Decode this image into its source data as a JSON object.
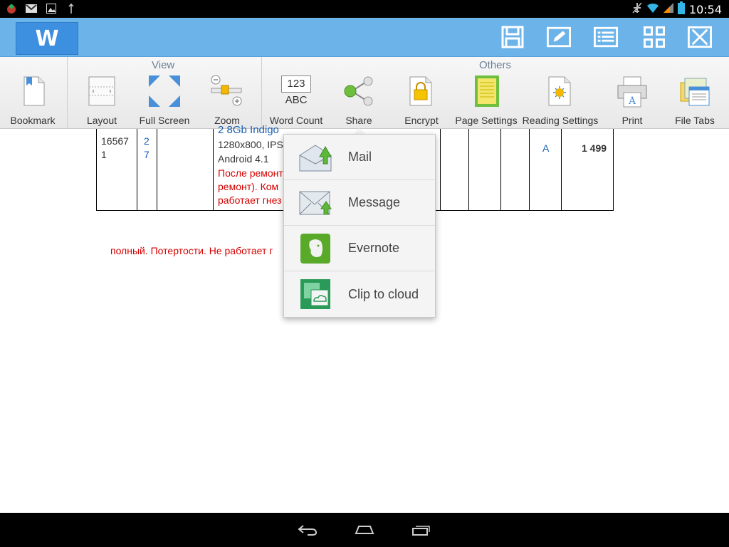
{
  "status_bar": {
    "time": "10:54",
    "icons_left": [
      "app-notification-icon",
      "gmail-icon",
      "gallery-icon",
      "usb-debug-icon"
    ],
    "icons_right": [
      "airplane-off-icon",
      "wifi-icon",
      "signal-icon",
      "battery-icon"
    ]
  },
  "titlebar": {
    "logo_letter": "W",
    "buttons": [
      "save-icon",
      "edit-icon",
      "list-icon",
      "grid-icon",
      "close-icon"
    ]
  },
  "ribbon": {
    "groups": [
      {
        "label": "View"
      },
      {
        "label": "Others"
      }
    ],
    "tools": [
      {
        "id": "bookmark",
        "label": "Bookmark"
      },
      {
        "id": "layout",
        "label": "Layout"
      },
      {
        "id": "fullscreen",
        "label": "Full Screen"
      },
      {
        "id": "zoom",
        "label": "Zoom"
      },
      {
        "id": "wordcount",
        "label": "Word Count",
        "icon_text_top": "123",
        "icon_text_bottom": "ABC"
      },
      {
        "id": "share",
        "label": "Share"
      },
      {
        "id": "encrypt",
        "label": "Encrypt"
      },
      {
        "id": "pagesettings",
        "label": "Page Settings"
      },
      {
        "id": "readingsettings",
        "label": "Reading Settings"
      },
      {
        "id": "print",
        "label": "Print"
      },
      {
        "id": "filetabs",
        "label": "File Tabs"
      }
    ]
  },
  "document": {
    "row": {
      "code_line1": "16567",
      "code_line2": "1",
      "qty_line1": "2",
      "qty_line2": "7",
      "desc_title": "2 8Gb Indigo",
      "desc_line1": "1280x800, IPS",
      "desc_line2": "Android 4.1",
      "desc_red1": "После ремонт",
      "desc_red2": "ремонт). Ком",
      "desc_red3": "работает гнез",
      "grade": "A",
      "price": "1 499"
    },
    "note": "полный. Потертости. Не работает г"
  },
  "share_menu": {
    "items": [
      {
        "label": "Mail",
        "icon": "mail-icon"
      },
      {
        "label": "Message",
        "icon": "message-icon"
      },
      {
        "label": "Evernote",
        "icon": "evernote-icon"
      },
      {
        "label": "Clip to cloud",
        "icon": "clip-to-cloud-icon"
      }
    ]
  },
  "navbar": {
    "buttons": [
      "back-icon",
      "home-icon",
      "recent-apps-icon"
    ]
  }
}
